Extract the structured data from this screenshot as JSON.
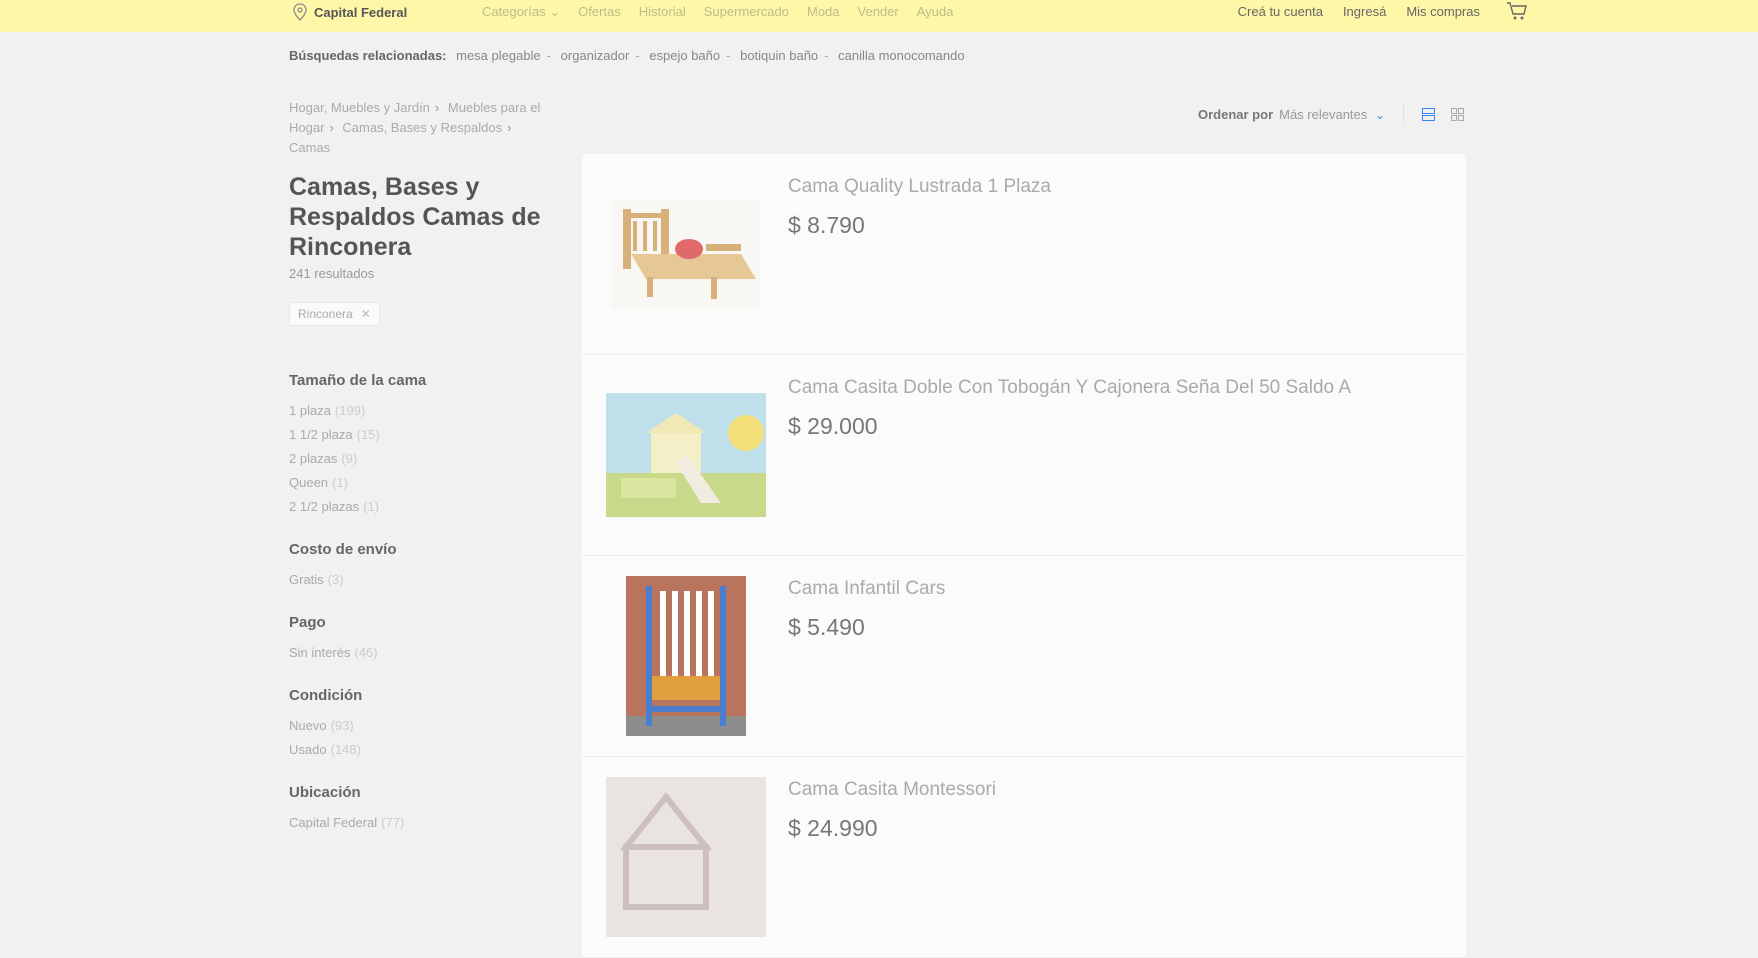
{
  "header": {
    "location": "Capital Federal",
    "nav": [
      "Categorías",
      "Ofertas",
      "Historial",
      "Supermercado",
      "Moda",
      "Vender",
      "Ayuda"
    ],
    "user_links": [
      "Creá tu cuenta",
      "Ingresá",
      "Mis compras"
    ]
  },
  "related": {
    "label": "Búsquedas relacionadas:",
    "items": [
      "mesa plegable",
      "organizador",
      "espejo baño",
      "botiquin baño",
      "canilla monocomando"
    ]
  },
  "breadcrumb": [
    "Hogar, Muebles y Jardín",
    "Muebles para el Hogar",
    "Camas, Bases y Respaldos",
    "Camas"
  ],
  "page_title": "Camas, Bases y Respaldos Camas de Rinconera",
  "result_count": "241 resultados",
  "filter_chip": "Rinconera",
  "facets": [
    {
      "title": "Tamaño de la cama",
      "items": [
        {
          "label": "1 plaza",
          "count": "(199)"
        },
        {
          "label": "1 1/2 plaza",
          "count": "(15)"
        },
        {
          "label": "2 plazas",
          "count": "(9)"
        },
        {
          "label": "Queen",
          "count": "(1)"
        },
        {
          "label": "2 1/2 plazas",
          "count": "(1)"
        }
      ]
    },
    {
      "title": "Costo de envío",
      "items": [
        {
          "label": "Gratis",
          "count": "(3)"
        }
      ]
    },
    {
      "title": "Pago",
      "items": [
        {
          "label": "Sin interés",
          "count": "(46)"
        }
      ]
    },
    {
      "title": "Condición",
      "items": [
        {
          "label": "Nuevo",
          "count": "(93)"
        },
        {
          "label": "Usado",
          "count": "(148)"
        }
      ]
    },
    {
      "title": "Ubicación",
      "items": [
        {
          "label": "Capital Federal",
          "count": "(77)"
        }
      ]
    }
  ],
  "sort": {
    "label": "Ordenar por",
    "value": "Más relevantes"
  },
  "results": [
    {
      "title": "Cama Quality Lustrada 1 Plaza",
      "price": "$ 8.790"
    },
    {
      "title": "Cama Casita Doble Con Tobogán Y Cajonera Seña Del 50 Saldo A",
      "price": "$ 29.000"
    },
    {
      "title": "Cama Infantil Cars",
      "price": "$ 5.490"
    },
    {
      "title": "Cama Casita Montessori",
      "price": "$ 24.990"
    }
  ],
  "colors": {
    "header_bg": "#fff7a8",
    "accent": "#3483fa",
    "page_bg": "#f1f1f1"
  }
}
